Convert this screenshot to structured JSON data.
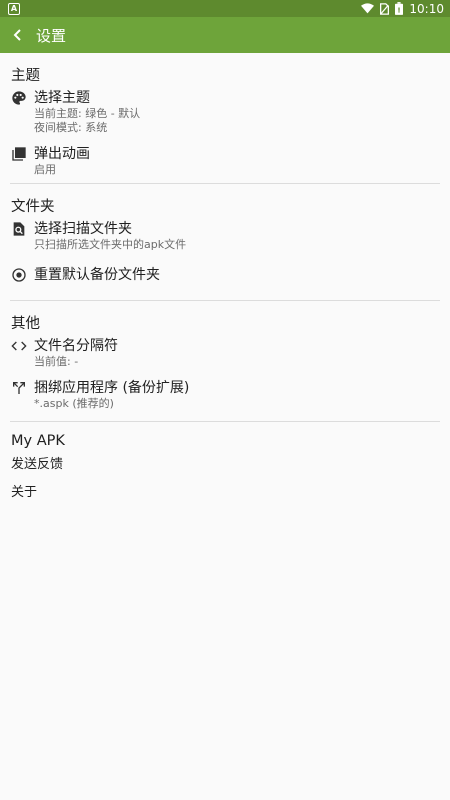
{
  "status_bar": {
    "notification_badge": "A",
    "time": "10:10"
  },
  "toolbar": {
    "title": "设置"
  },
  "sections": {
    "theme": {
      "header": "主题",
      "choose_theme": {
        "title": "选择主题",
        "summary1": "当前主题: 绿色 - 默认",
        "summary2": "夜间模式: 系统"
      },
      "popup_animation": {
        "title": "弹出动画",
        "summary": "启用"
      }
    },
    "folder": {
      "header": "文件夹",
      "choose_scan_folder": {
        "title": "选择扫描文件夹",
        "summary": "只扫描所选文件夹中的apk文件"
      },
      "reset_backup_folder": {
        "title": "重置默认备份文件夹"
      }
    },
    "other": {
      "header": "其他",
      "filename_separator": {
        "title": "文件名分隔符",
        "summary": "当前值: -"
      },
      "bundle_apps": {
        "title": "捆绑应用程序 (备份扩展)",
        "summary": "*.aspk (推荐的)"
      }
    },
    "my_apk": {
      "header": "My APK",
      "send_feedback": "发送反馈",
      "about": "关于"
    }
  },
  "colors": {
    "toolbar": "#6ea43a",
    "status_bar": "#5e8a2e",
    "background": "#fafafa"
  }
}
